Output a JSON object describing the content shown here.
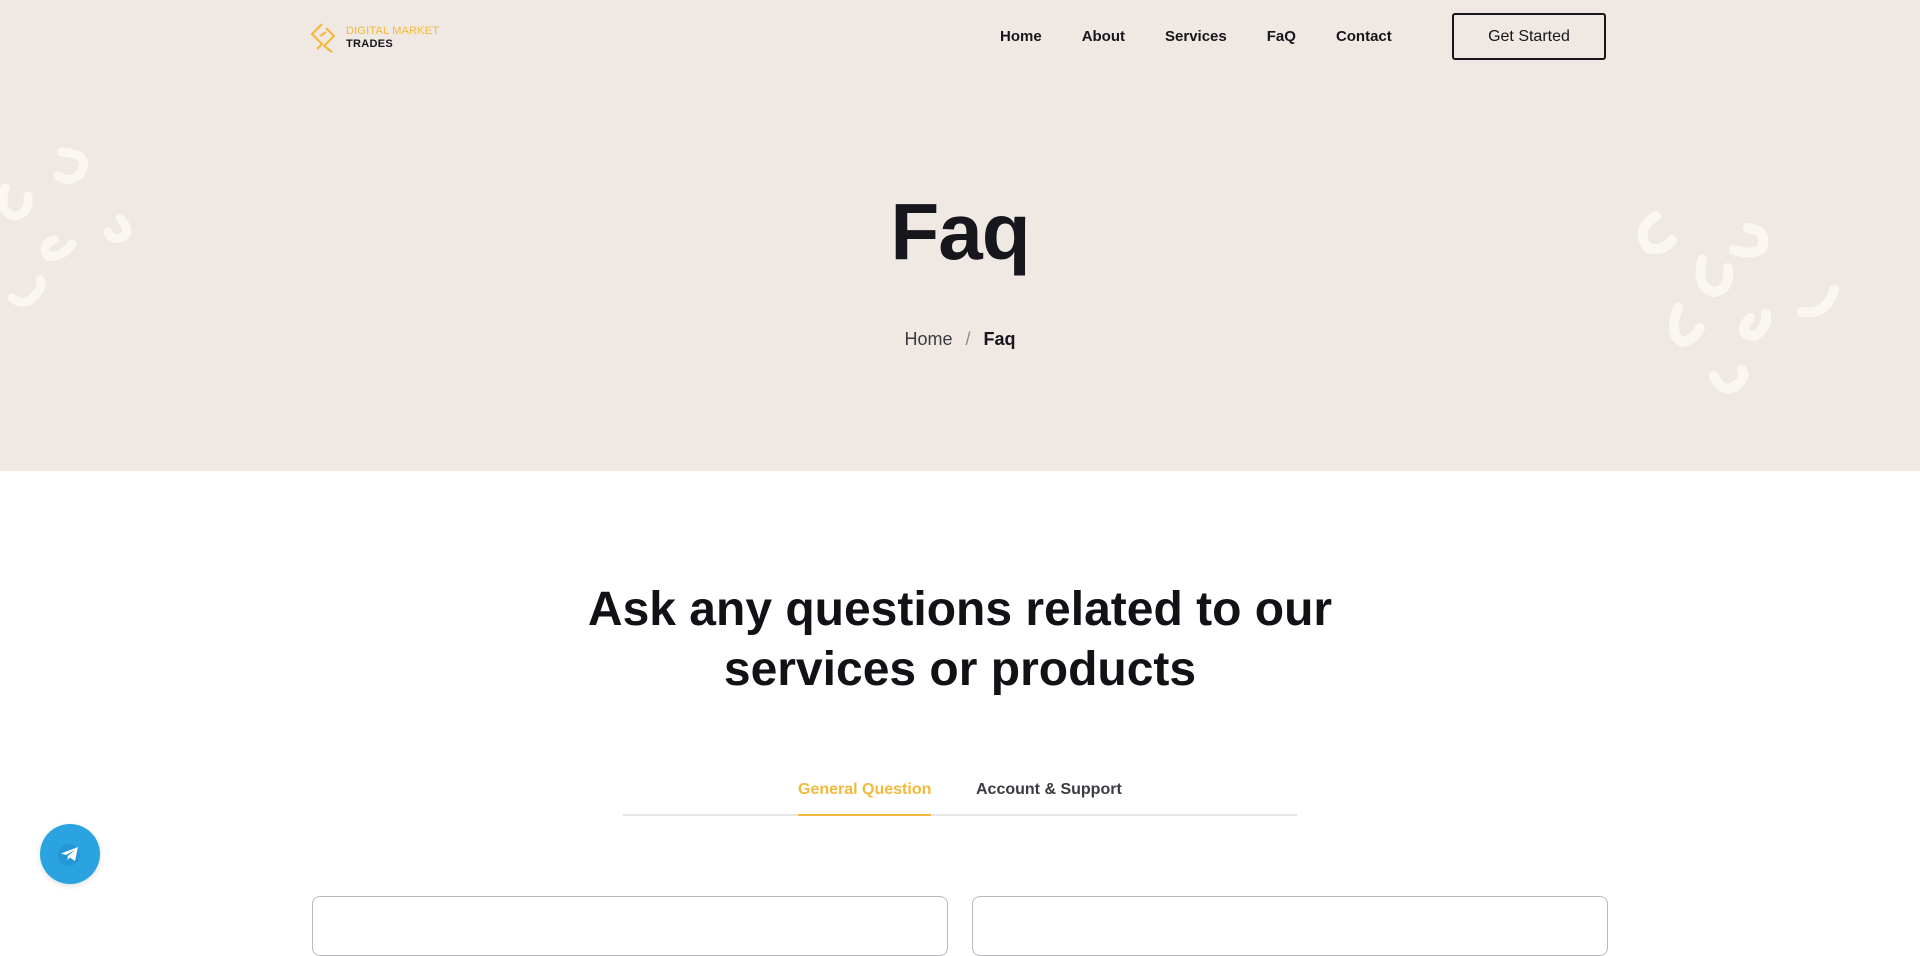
{
  "brand": {
    "line1": "DIGITAL MARKET",
    "line2": "TRADES",
    "accent_color": "#f2b93b",
    "text_color": "#16161c"
  },
  "nav": {
    "items": [
      {
        "label": "Home"
      },
      {
        "label": "About"
      },
      {
        "label": "Services"
      },
      {
        "label": "FaQ"
      },
      {
        "label": "Contact"
      }
    ],
    "cta_label": "Get Started"
  },
  "hero": {
    "title": "Faq",
    "background": "#f0e9e3",
    "breadcrumb": {
      "home": "Home",
      "separator": "/",
      "current": "Faq"
    }
  },
  "faq_section": {
    "heading": "Ask any questions related to our services or products",
    "tabs": [
      {
        "label": "General Question",
        "active": true
      },
      {
        "label": "Account & Support",
        "active": false
      }
    ]
  },
  "floating": {
    "icon": "telegram-icon",
    "color": "#2aa3e0"
  }
}
